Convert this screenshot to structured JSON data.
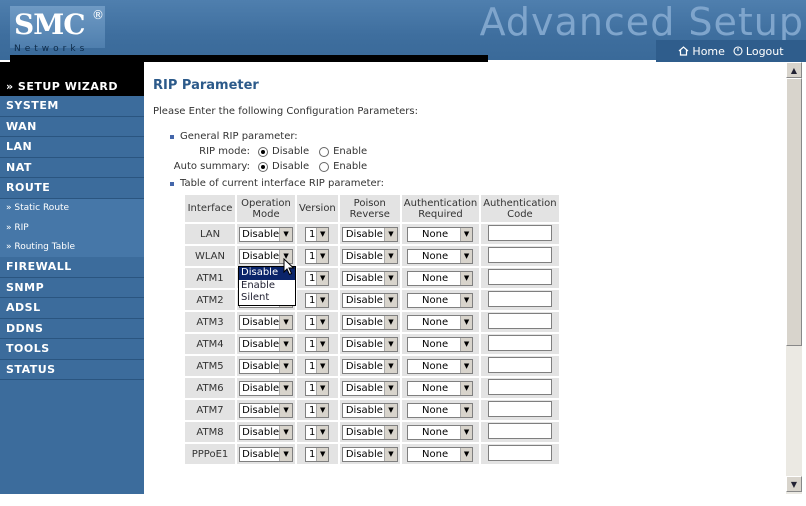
{
  "header": {
    "logo": "SMC",
    "logo_reg": "®",
    "logo_sub": "Networks",
    "banner": "Advanced Setup",
    "home_label": "Home",
    "logout_label": "Logout"
  },
  "sidebar": {
    "wizard": "» SETUP WIZARD",
    "items": [
      "SYSTEM",
      "WAN",
      "LAN",
      "NAT",
      "ROUTE"
    ],
    "sub_items": [
      "» Static Route",
      "» RIP",
      "» Routing Table"
    ],
    "items_after": [
      "FIREWALL",
      "SNMP",
      "ADSL",
      "DDNS",
      "TOOLS",
      "STATUS"
    ]
  },
  "main": {
    "title": "RIP Parameter",
    "intro": "Please Enter the following Configuration Parameters:",
    "general_heading": "General RIP parameter:",
    "rip_mode_label": "RIP mode:",
    "auto_summary_label": "Auto summary:",
    "opt_disable": "Disable",
    "opt_enable": "Enable",
    "rip_mode_value": "Disable",
    "auto_summary_value": "Disable",
    "table_heading": "Table of current interface RIP parameter:",
    "columns": [
      "Interface",
      "Operation Mode",
      "Version",
      "Poison Reverse",
      "Authentication Required",
      "Authentication Code"
    ],
    "rows": [
      {
        "interface": "LAN",
        "mode": "Disable",
        "version": "1",
        "poison": "Disable",
        "auth": "None"
      },
      {
        "interface": "WLAN",
        "mode": "Disable",
        "version": "1",
        "poison": "Disable",
        "auth": "None"
      },
      {
        "interface": "ATM1",
        "mode": "Disable",
        "version": "1",
        "poison": "Disable",
        "auth": "None"
      },
      {
        "interface": "ATM2",
        "mode": "Disable",
        "version": "1",
        "poison": "Disable",
        "auth": "None"
      },
      {
        "interface": "ATM3",
        "mode": "Disable",
        "version": "1",
        "poison": "Disable",
        "auth": "None"
      },
      {
        "interface": "ATM4",
        "mode": "Disable",
        "version": "1",
        "poison": "Disable",
        "auth": "None"
      },
      {
        "interface": "ATM5",
        "mode": "Disable",
        "version": "1",
        "poison": "Disable",
        "auth": "None"
      },
      {
        "interface": "ATM6",
        "mode": "Disable",
        "version": "1",
        "poison": "Disable",
        "auth": "None"
      },
      {
        "interface": "ATM7",
        "mode": "Disable",
        "version": "1",
        "poison": "Disable",
        "auth": "None"
      },
      {
        "interface": "ATM8",
        "mode": "Disable",
        "version": "1",
        "poison": "Disable",
        "auth": "None"
      },
      {
        "interface": "PPPoE1",
        "mode": "Disable",
        "version": "1",
        "poison": "Disable",
        "auth": "None"
      }
    ],
    "dropdown_options": [
      "Disable",
      "Enable",
      "Silent"
    ]
  },
  "colors": {
    "header_blue": "#3e6e9e",
    "sidebar_blue": "#3c6c9c",
    "title_blue": "#2c5a8a",
    "cell_gray": "#e3e3e3"
  }
}
